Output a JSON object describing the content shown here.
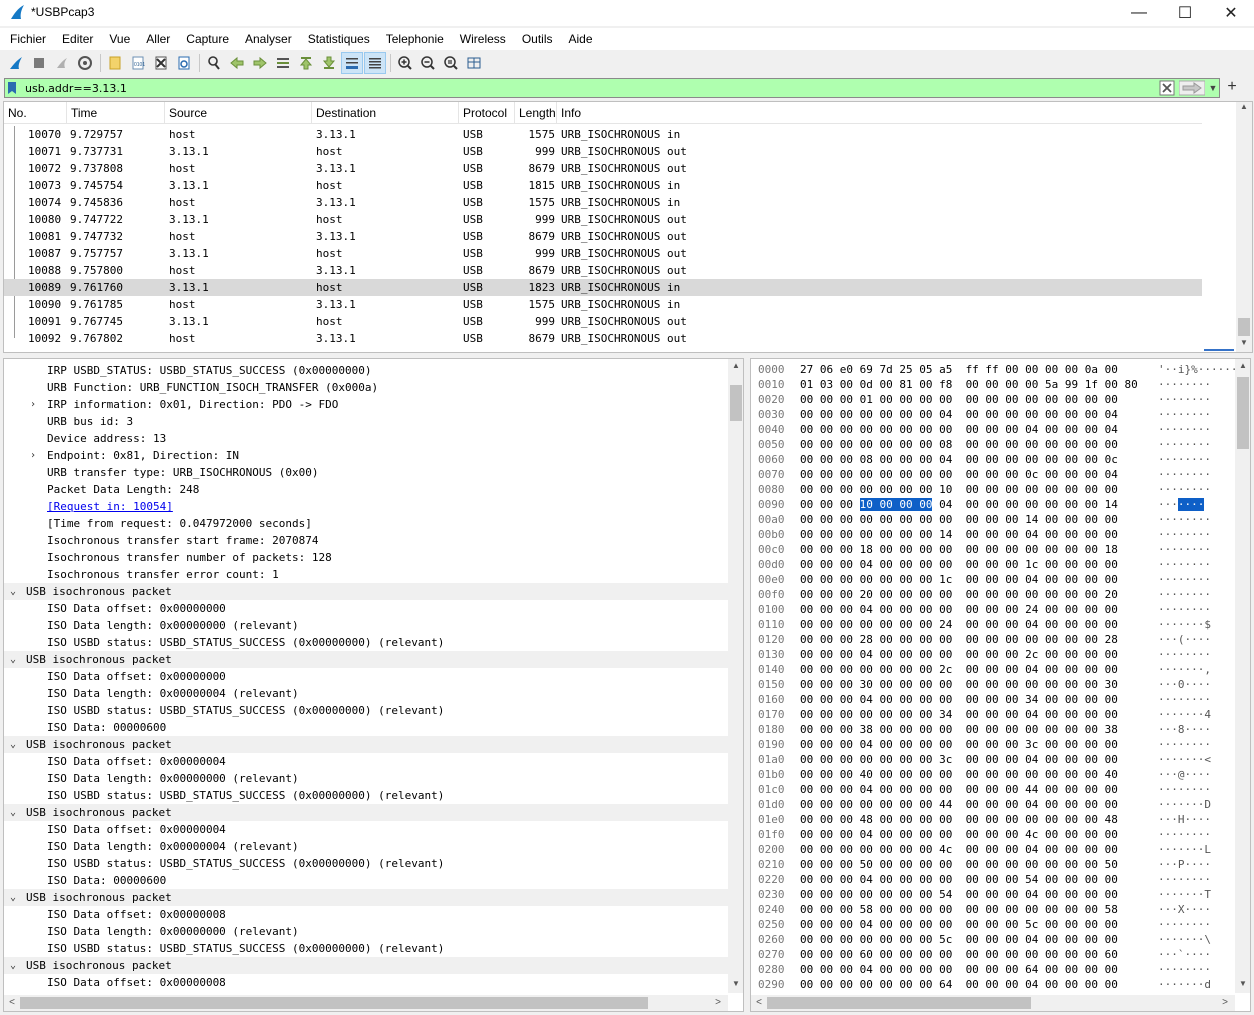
{
  "window": {
    "title": "*USBPcap3",
    "minimize": "—",
    "maximize": "☐",
    "close": "✕"
  },
  "menu": [
    "Fichier",
    "Editer",
    "Vue",
    "Aller",
    "Capture",
    "Analyser",
    "Statistiques",
    "Telephonie",
    "Wireless",
    "Outils",
    "Aide"
  ],
  "toolbar": {
    "buttons": [
      "start-capture-icon",
      "stop-capture-icon",
      "restart-capture-icon",
      "capture-options-icon",
      "open-file-icon",
      "open-recent-icon",
      "close-file-icon",
      "reload-file-icon",
      "find-packet-icon",
      "go-back-icon",
      "go-forward-icon",
      "go-to-packet-icon",
      "go-first-icon",
      "go-last-icon",
      "autoscroll-icon",
      "colorize-icon",
      "zoom-in-icon",
      "zoom-out-icon",
      "zoom-normal-icon",
      "resize-columns-icon"
    ],
    "active": [
      "autoscroll-icon",
      "colorize-icon"
    ]
  },
  "filter": {
    "value": "usb.addr==3.13.1",
    "bg_color": "#afffaf",
    "add_label": "+"
  },
  "packet_list": {
    "columns": [
      "No.",
      "Time",
      "Source",
      "Destination",
      "Protocol",
      "Length",
      "Info"
    ],
    "rows": [
      {
        "no": "10070",
        "time": "9.729757",
        "src": "host",
        "dst": "3.13.1",
        "proto": "USB",
        "len": "1575",
        "info": "URB_ISOCHRONOUS in"
      },
      {
        "no": "10071",
        "time": "9.737731",
        "src": "3.13.1",
        "dst": "host",
        "proto": "USB",
        "len": "999",
        "info": "URB_ISOCHRONOUS out"
      },
      {
        "no": "10072",
        "time": "9.737808",
        "src": "host",
        "dst": "3.13.1",
        "proto": "USB",
        "len": "8679",
        "info": "URB_ISOCHRONOUS out"
      },
      {
        "no": "10073",
        "time": "9.745754",
        "src": "3.13.1",
        "dst": "host",
        "proto": "USB",
        "len": "1815",
        "info": "URB_ISOCHRONOUS in"
      },
      {
        "no": "10074",
        "time": "9.745836",
        "src": "host",
        "dst": "3.13.1",
        "proto": "USB",
        "len": "1575",
        "info": "URB_ISOCHRONOUS in"
      },
      {
        "no": "10080",
        "time": "9.747722",
        "src": "3.13.1",
        "dst": "host",
        "proto": "USB",
        "len": "999",
        "info": "URB_ISOCHRONOUS out"
      },
      {
        "no": "10081",
        "time": "9.747732",
        "src": "host",
        "dst": "3.13.1",
        "proto": "USB",
        "len": "8679",
        "info": "URB_ISOCHRONOUS out"
      },
      {
        "no": "10087",
        "time": "9.757757",
        "src": "3.13.1",
        "dst": "host",
        "proto": "USB",
        "len": "999",
        "info": "URB_ISOCHRONOUS out"
      },
      {
        "no": "10088",
        "time": "9.757800",
        "src": "host",
        "dst": "3.13.1",
        "proto": "USB",
        "len": "8679",
        "info": "URB_ISOCHRONOUS out"
      },
      {
        "no": "10089",
        "time": "9.761760",
        "src": "3.13.1",
        "dst": "host",
        "proto": "USB",
        "len": "1823",
        "info": "URB_ISOCHRONOUS in"
      },
      {
        "no": "10090",
        "time": "9.761785",
        "src": "host",
        "dst": "3.13.1",
        "proto": "USB",
        "len": "1575",
        "info": "URB_ISOCHRONOUS in"
      },
      {
        "no": "10091",
        "time": "9.767745",
        "src": "3.13.1",
        "dst": "host",
        "proto": "USB",
        "len": "999",
        "info": "URB_ISOCHRONOUS out"
      },
      {
        "no": "10092",
        "time": "9.767802",
        "src": "host",
        "dst": "3.13.1",
        "proto": "USB",
        "len": "8679",
        "info": "URB_ISOCHRONOUS out"
      }
    ],
    "selected_no": "10089",
    "selected_color": "#d9d9d9"
  },
  "details": {
    "rows": [
      {
        "text": "IRP USBD_STATUS: USBD_STATUS_SUCCESS (0x00000000)",
        "level": 1,
        "arrow": ""
      },
      {
        "text": "URB Function: URB_FUNCTION_ISOCH_TRANSFER (0x000a)",
        "level": 1,
        "arrow": ""
      },
      {
        "text": "IRP information: 0x01, Direction: PDO -> FDO",
        "level": 1,
        "arrow": ">"
      },
      {
        "text": "URB bus id: 3",
        "level": 1,
        "arrow": ""
      },
      {
        "text": "Device address: 13",
        "level": 1,
        "arrow": ""
      },
      {
        "text": "Endpoint: 0x81, Direction: IN",
        "level": 1,
        "arrow": ">"
      },
      {
        "text": "URB transfer type: URB_ISOCHRONOUS (0x00)",
        "level": 1,
        "arrow": ""
      },
      {
        "text": "Packet Data Length: 248",
        "level": 1,
        "arrow": ""
      },
      {
        "text": "[Request in: 10054]",
        "level": 1,
        "arrow": "",
        "link": true
      },
      {
        "text": "[Time from request: 0.047972000 seconds]",
        "level": 1,
        "arrow": ""
      },
      {
        "text": "Isochronous transfer start frame: 2070874",
        "level": 1,
        "arrow": ""
      },
      {
        "text": "Isochronous transfer number of packets: 128",
        "level": 1,
        "arrow": ""
      },
      {
        "text": "Isochronous transfer error count: 1",
        "level": 1,
        "arrow": ""
      },
      {
        "text": "USB isochronous packet",
        "level": 0,
        "arrow": "v",
        "group": true
      },
      {
        "text": "ISO Data offset: 0x00000000",
        "level": 1,
        "arrow": ""
      },
      {
        "text": "ISO Data length: 0x00000000 (relevant)",
        "level": 1,
        "arrow": ""
      },
      {
        "text": "ISO USBD status: USBD_STATUS_SUCCESS (0x00000000) (relevant)",
        "level": 1,
        "arrow": ""
      },
      {
        "text": "USB isochronous packet",
        "level": 0,
        "arrow": "v",
        "group": true
      },
      {
        "text": "ISO Data offset: 0x00000000",
        "level": 1,
        "arrow": ""
      },
      {
        "text": "ISO Data length: 0x00000004 (relevant)",
        "level": 1,
        "arrow": ""
      },
      {
        "text": "ISO USBD status: USBD_STATUS_SUCCESS (0x00000000) (relevant)",
        "level": 1,
        "arrow": ""
      },
      {
        "text": "ISO Data: 00000600",
        "level": 1,
        "arrow": ""
      },
      {
        "text": "USB isochronous packet",
        "level": 0,
        "arrow": "v",
        "group": true
      },
      {
        "text": "ISO Data offset: 0x00000004",
        "level": 1,
        "arrow": ""
      },
      {
        "text": "ISO Data length: 0x00000000 (relevant)",
        "level": 1,
        "arrow": ""
      },
      {
        "text": "ISO USBD status: USBD_STATUS_SUCCESS (0x00000000) (relevant)",
        "level": 1,
        "arrow": ""
      },
      {
        "text": "USB isochronous packet",
        "level": 0,
        "arrow": "v",
        "group": true
      },
      {
        "text": "ISO Data offset: 0x00000004",
        "level": 1,
        "arrow": ""
      },
      {
        "text": "ISO Data length: 0x00000004 (relevant)",
        "level": 1,
        "arrow": ""
      },
      {
        "text": "ISO USBD status: USBD_STATUS_SUCCESS (0x00000000) (relevant)",
        "level": 1,
        "arrow": ""
      },
      {
        "text": "ISO Data: 00000600",
        "level": 1,
        "arrow": ""
      },
      {
        "text": "USB isochronous packet",
        "level": 0,
        "arrow": "v",
        "group": true
      },
      {
        "text": "ISO Data offset: 0x00000008",
        "level": 1,
        "arrow": ""
      },
      {
        "text": "ISO Data length: 0x00000000 (relevant)",
        "level": 1,
        "arrow": ""
      },
      {
        "text": "ISO USBD status: USBD_STATUS_SUCCESS (0x00000000) (relevant)",
        "level": 1,
        "arrow": ""
      },
      {
        "text": "USB isochronous packet",
        "level": 0,
        "arrow": "v",
        "group": true
      },
      {
        "text": "ISO Data offset: 0x00000008",
        "level": 1,
        "arrow": ""
      }
    ]
  },
  "hex": {
    "highlight_color": "#0e5fc7",
    "rows": [
      {
        "off": "0000",
        "bytes": "27 06 e0 69 7d 25 05 a5  ff ff 00 00 00 00 0a 00",
        "ascii": "'··i}%······"
      },
      {
        "off": "0010",
        "bytes": "01 03 00 0d 00 81 00 f8  00 00 00 00 5a 99 1f 00 80",
        "ascii": "········"
      },
      {
        "off": "0020",
        "bytes": "00 00 00 01 00 00 00 00  00 00 00 00 00 00 00 00",
        "ascii": "········"
      },
      {
        "off": "0030",
        "bytes": "00 00 00 00 00 00 00 04  00 00 00 00 00 00 00 04",
        "ascii": "········"
      },
      {
        "off": "0040",
        "bytes": "00 00 00 00 00 00 00 00  00 00 00 04 00 00 00 04",
        "ascii": "········"
      },
      {
        "off": "0050",
        "bytes": "00 00 00 00 00 00 00 08  00 00 00 00 00 00 00 00",
        "ascii": "········"
      },
      {
        "off": "0060",
        "bytes": "00 00 00 08 00 00 00 04  00 00 00 00 00 00 00 0c",
        "ascii": "········"
      },
      {
        "off": "0070",
        "bytes": "00 00 00 00 00 00 00 00  00 00 00 0c 00 00 00 04",
        "ascii": "········"
      },
      {
        "off": "0080",
        "bytes": "00 00 00 00 00 00 00 10  00 00 00 00 00 00 00 00",
        "ascii": "········"
      },
      {
        "off": "0090",
        "bytes": "00 00 00 10 00 00 00 04  00 00 00 00 00 00 00 14",
        "ascii": "···",
        "hl_bytes": "10 00 00 00",
        "hl_ascii": "····"
      },
      {
        "off": "00a0",
        "bytes": "00 00 00 00 00 00 00 00  00 00 00 14 00 00 00 00",
        "ascii": "········"
      },
      {
        "off": "00b0",
        "bytes": "00 00 00 00 00 00 00 14  00 00 00 04 00 00 00 00",
        "ascii": "········"
      },
      {
        "off": "00c0",
        "bytes": "00 00 00 18 00 00 00 00  00 00 00 00 00 00 00 18",
        "ascii": "········"
      },
      {
        "off": "00d0",
        "bytes": "00 00 00 04 00 00 00 00  00 00 00 1c 00 00 00 00",
        "ascii": "········"
      },
      {
        "off": "00e0",
        "bytes": "00 00 00 00 00 00 00 1c  00 00 00 04 00 00 00 00",
        "ascii": "········"
      },
      {
        "off": "00f0",
        "bytes": "00 00 00 20 00 00 00 00  00 00 00 00 00 00 00 20",
        "ascii": "········"
      },
      {
        "off": "0100",
        "bytes": "00 00 00 04 00 00 00 00  00 00 00 24 00 00 00 00",
        "ascii": "········"
      },
      {
        "off": "0110",
        "bytes": "00 00 00 00 00 00 00 24  00 00 00 04 00 00 00 00",
        "ascii": "·······$"
      },
      {
        "off": "0120",
        "bytes": "00 00 00 28 00 00 00 00  00 00 00 00 00 00 00 28",
        "ascii": "···(····"
      },
      {
        "off": "0130",
        "bytes": "00 00 00 04 00 00 00 00  00 00 00 2c 00 00 00 00",
        "ascii": "········"
      },
      {
        "off": "0140",
        "bytes": "00 00 00 00 00 00 00 2c  00 00 00 04 00 00 00 00",
        "ascii": "·······,"
      },
      {
        "off": "0150",
        "bytes": "00 00 00 30 00 00 00 00  00 00 00 00 00 00 00 30",
        "ascii": "···0····"
      },
      {
        "off": "0160",
        "bytes": "00 00 00 04 00 00 00 00  00 00 00 34 00 00 00 00",
        "ascii": "········"
      },
      {
        "off": "0170",
        "bytes": "00 00 00 00 00 00 00 34  00 00 00 04 00 00 00 00",
        "ascii": "·······4"
      },
      {
        "off": "0180",
        "bytes": "00 00 00 38 00 00 00 00  00 00 00 00 00 00 00 38",
        "ascii": "···8····"
      },
      {
        "off": "0190",
        "bytes": "00 00 00 04 00 00 00 00  00 00 00 3c 00 00 00 00",
        "ascii": "········"
      },
      {
        "off": "01a0",
        "bytes": "00 00 00 00 00 00 00 3c  00 00 00 04 00 00 00 00",
        "ascii": "·······<"
      },
      {
        "off": "01b0",
        "bytes": "00 00 00 40 00 00 00 00  00 00 00 00 00 00 00 40",
        "ascii": "···@····"
      },
      {
        "off": "01c0",
        "bytes": "00 00 00 04 00 00 00 00  00 00 00 44 00 00 00 00",
        "ascii": "········"
      },
      {
        "off": "01d0",
        "bytes": "00 00 00 00 00 00 00 44  00 00 00 04 00 00 00 00",
        "ascii": "·······D"
      },
      {
        "off": "01e0",
        "bytes": "00 00 00 48 00 00 00 00  00 00 00 00 00 00 00 48",
        "ascii": "···H····"
      },
      {
        "off": "01f0",
        "bytes": "00 00 00 04 00 00 00 00  00 00 00 4c 00 00 00 00",
        "ascii": "········"
      },
      {
        "off": "0200",
        "bytes": "00 00 00 00 00 00 00 4c  00 00 00 04 00 00 00 00",
        "ascii": "·······L"
      },
      {
        "off": "0210",
        "bytes": "00 00 00 50 00 00 00 00  00 00 00 00 00 00 00 50",
        "ascii": "···P····"
      },
      {
        "off": "0220",
        "bytes": "00 00 00 04 00 00 00 00  00 00 00 54 00 00 00 00",
        "ascii": "········"
      },
      {
        "off": "0230",
        "bytes": "00 00 00 00 00 00 00 54  00 00 00 04 00 00 00 00",
        "ascii": "·······T"
      },
      {
        "off": "0240",
        "bytes": "00 00 00 58 00 00 00 00  00 00 00 00 00 00 00 58",
        "ascii": "···X····"
      },
      {
        "off": "0250",
        "bytes": "00 00 00 04 00 00 00 00  00 00 00 5c 00 00 00 00",
        "ascii": "········"
      },
      {
        "off": "0260",
        "bytes": "00 00 00 00 00 00 00 5c  00 00 00 04 00 00 00 00",
        "ascii": "·······\\"
      },
      {
        "off": "0270",
        "bytes": "00 00 00 60 00 00 00 00  00 00 00 00 00 00 00 60",
        "ascii": "···`····"
      },
      {
        "off": "0280",
        "bytes": "00 00 00 04 00 00 00 00  00 00 00 64 00 00 00 00",
        "ascii": "········"
      },
      {
        "off": "0290",
        "bytes": "00 00 00 00 00 00 00 64  00 00 00 04 00 00 00 00",
        "ascii": "·······d"
      }
    ]
  }
}
